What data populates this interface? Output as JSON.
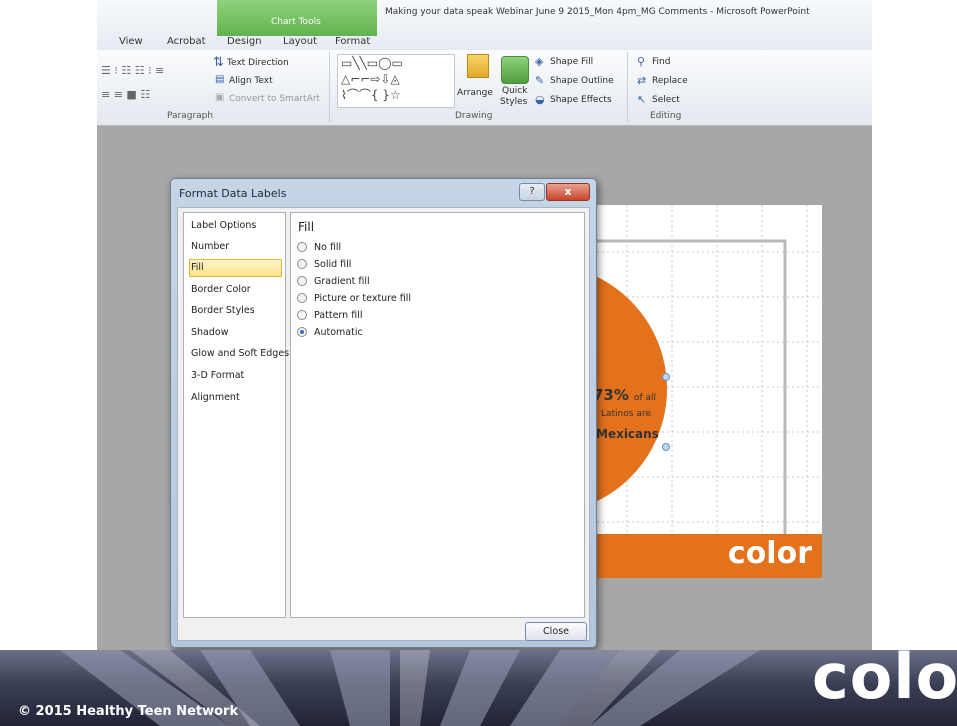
{
  "window_title": "Making your data speak Webinar June 9 2015_Mon 4pm_MG Comments - Microsoft PowerPoint",
  "ribbon": {
    "context_tab": "Chart Tools",
    "tabs": [
      "View",
      "Acrobat",
      "Design",
      "Layout",
      "Format"
    ],
    "text_direction": "Text Direction",
    "align_text": "Align Text",
    "convert_smartart": "Convert to SmartArt",
    "arrange": "Arrange",
    "quick_styles_1": "Quick",
    "quick_styles_2": "Styles",
    "shape_fill": "Shape Fill",
    "shape_outline": "Shape Outline",
    "shape_effects": "Shape Effects",
    "find": "Find",
    "replace": "Replace",
    "select": "Select",
    "groups": {
      "paragraph": "Paragraph",
      "drawing": "Drawing",
      "editing": "Editing"
    }
  },
  "dialog": {
    "title": "Format Data Labels",
    "help": "?",
    "close_x": "x",
    "nav_items": [
      "Label Options",
      "Number",
      "Fill",
      "Border Color",
      "Border Styles",
      "Shadow",
      "Glow and Soft Edges",
      "3-D Format",
      "Alignment"
    ],
    "selected_nav": "Fill",
    "panel_title": "Fill",
    "options": [
      "No fill",
      "Solid fill",
      "Gradient fill",
      "Picture or texture fill",
      "Pattern fill",
      "Automatic"
    ],
    "selected_option": "Automatic",
    "close_button": "Close"
  },
  "slide": {
    "label_pct": "73%",
    "label_of_all": "of all",
    "label_latinos_are": "Latinos are",
    "label_mexicans": "Mexicans",
    "bar_word": "color",
    "accent_color": "#e4711b"
  },
  "footer": {
    "copyright": "© 2015 Healthy Teen Network",
    "word": "color"
  }
}
